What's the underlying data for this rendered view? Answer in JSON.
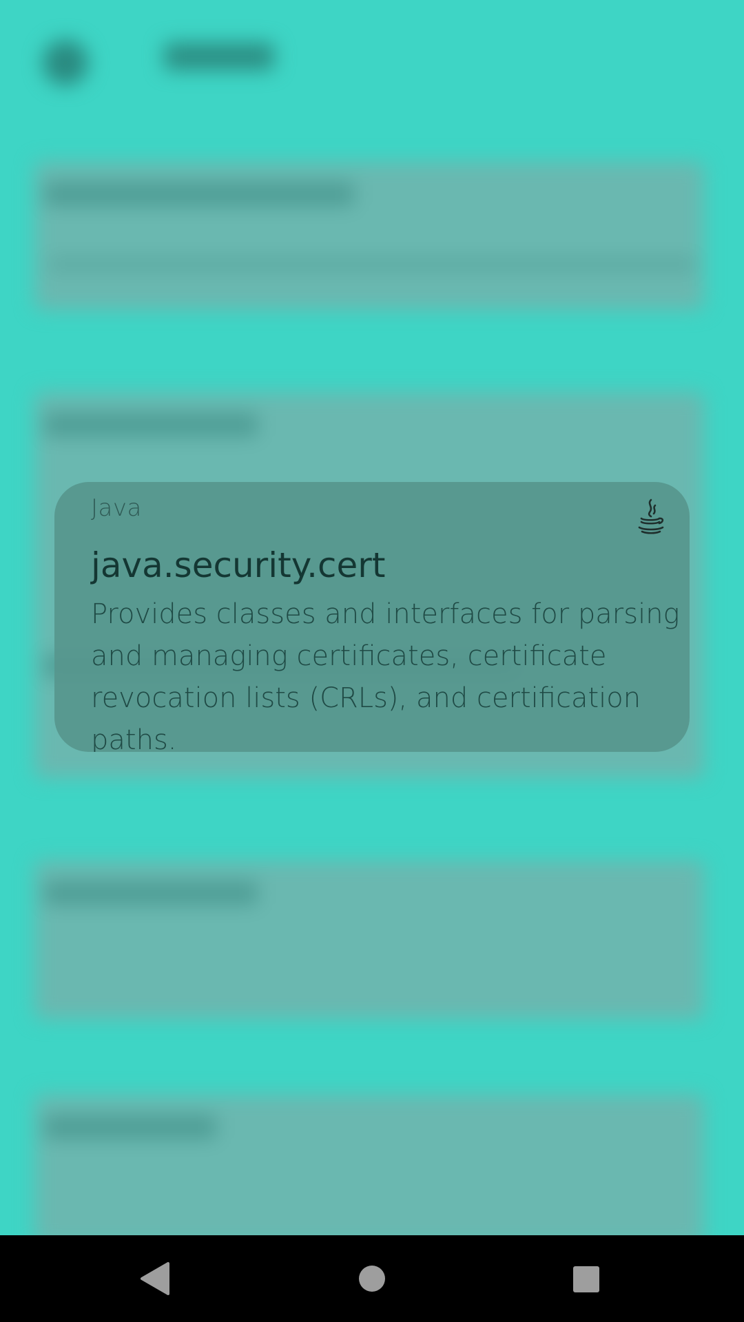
{
  "notification": {
    "app_name": "Java",
    "app_icon": "java-coffee-cup-icon",
    "title": "java.security.cert",
    "description": "Provides classes and interfaces for parsing and managing certificates, certificate revocation lists (CRLs), and certification paths."
  },
  "navigation_bar": {
    "back": "back-icon",
    "home": "home-icon",
    "recents": "recents-icon"
  },
  "colors": {
    "background": "#3ed5c5",
    "popup": "#5f968e",
    "navbar": "#000000"
  }
}
